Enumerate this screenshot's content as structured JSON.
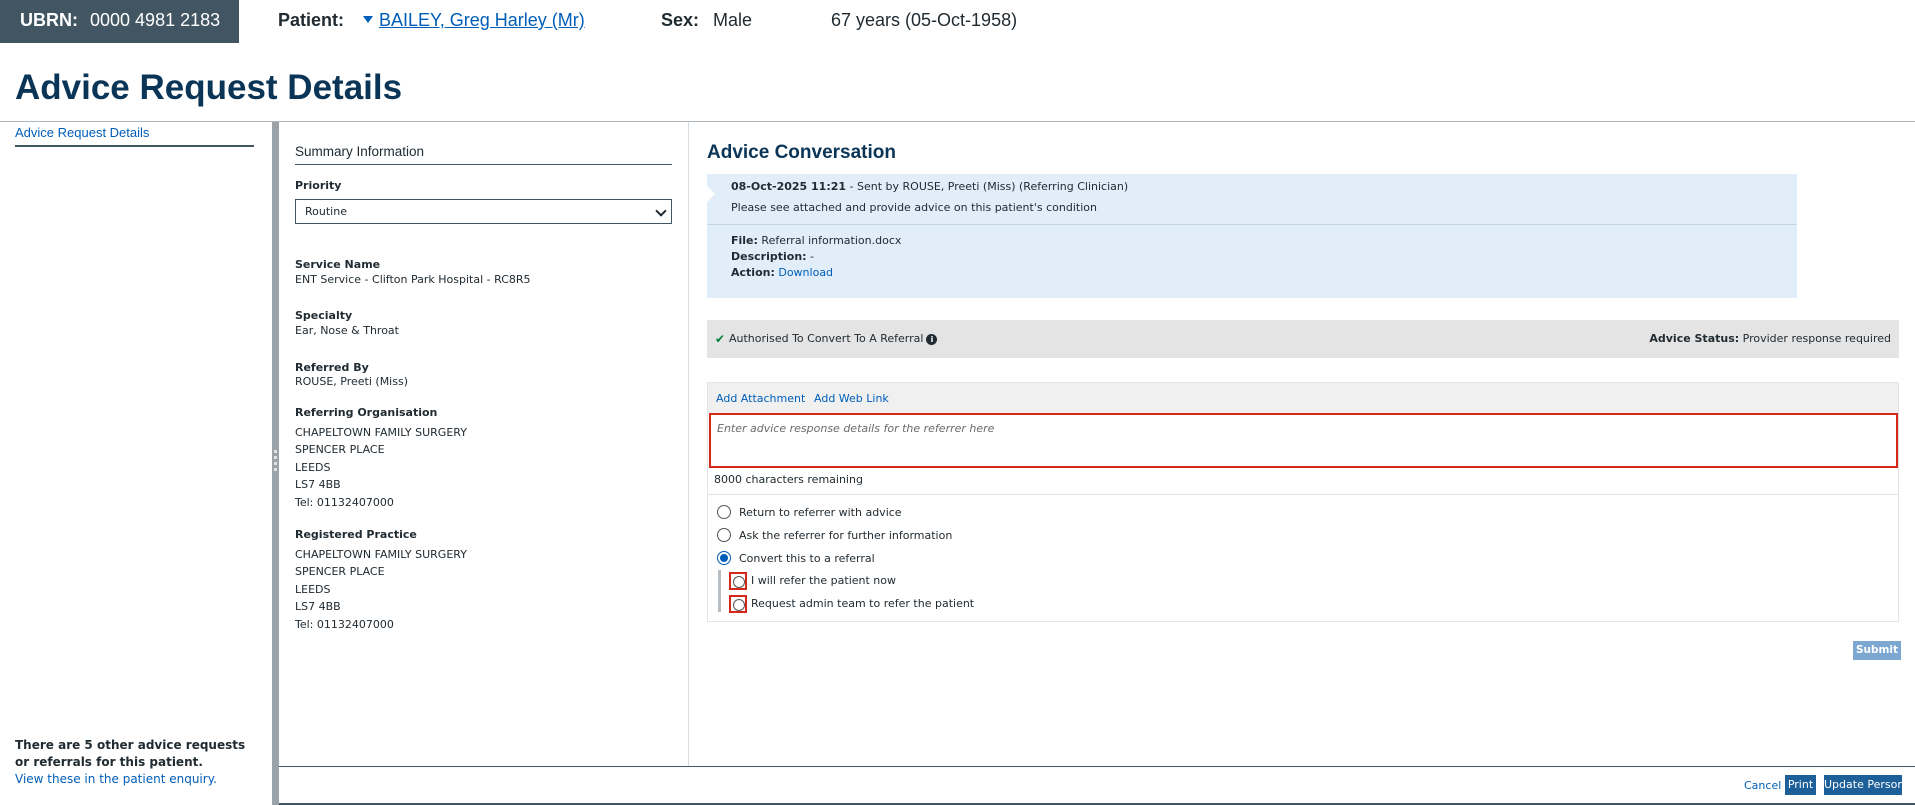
{
  "header": {
    "ubrn_label": "UBRN:",
    "ubrn_value": "0000 4981 2183",
    "patient_label": "Patient:",
    "patient_name": "BAILEY, Greg Harley (Mr)",
    "sex_label": "Sex:",
    "sex_value": "Male",
    "age": "67 years (05-Oct-1958)"
  },
  "page_title": "Advice Request Details",
  "left_nav": {
    "link": "Advice Request Details",
    "note_bold": "There are 5 other advice requests or referrals for this patient.",
    "note_link": "View these in the patient enquiry."
  },
  "summary": {
    "title": "Summary Information",
    "priority_label": "Priority",
    "priority_value": "Routine",
    "service_label": "Service Name",
    "service_value": "ENT Service - Clifton Park Hospital - RC8R5",
    "specialty_label": "Specialty",
    "specialty_value": "Ear, Nose & Throat",
    "referred_by_label": "Referred By",
    "referred_by_value": "ROUSE, Preeti (Miss)",
    "ref_org_label": "Referring Organisation",
    "ref_org_lines": [
      "CHAPELTOWN FAMILY SURGERY",
      "SPENCER PLACE",
      "LEEDS",
      "LS7 4BB",
      "Tel: 01132407000"
    ],
    "reg_practice_label": "Registered Practice",
    "reg_practice_lines": [
      "CHAPELTOWN FAMILY SURGERY",
      "SPENCER PLACE",
      "LEEDS",
      "LS7 4BB",
      "Tel: 01132407000"
    ]
  },
  "conversation": {
    "title": "Advice Conversation",
    "msg_timestamp": "08-Oct-2025 11:21",
    "msg_sender": " - Sent by ROUSE, Preeti (Miss) (Referring Clinician)",
    "msg_body": "Please see attached and provide advice on this patient's condition",
    "file_label": "File:",
    "file_value": " Referral information.docx",
    "desc_label": "Description:",
    "desc_value": " -",
    "action_label": "Action:",
    "action_link": "Download",
    "authorised": "Authorised To Convert To A Referral",
    "advice_status_label": "Advice Status:",
    "advice_status_value": " Provider response required",
    "add_attachment": "Add Attachment",
    "add_web_link": "Add Web Link",
    "response_placeholder": "Enter advice response details for the referrer here",
    "chars_remaining": "8000 characters remaining",
    "options": [
      "Return to referrer with advice",
      "Ask the referrer for further information",
      "Convert this to a referral"
    ],
    "sub_options": [
      "I will refer the patient now",
      "Request admin team to refer the patient"
    ],
    "submit": "Submit"
  },
  "footer": {
    "cancel": "Cancel",
    "print": "Print",
    "update_person": "Update Person"
  },
  "colors": {
    "header_bg": "#425563",
    "accent": "#005eb8",
    "error": "#d5281b",
    "message_bg": "#e1eefa"
  }
}
